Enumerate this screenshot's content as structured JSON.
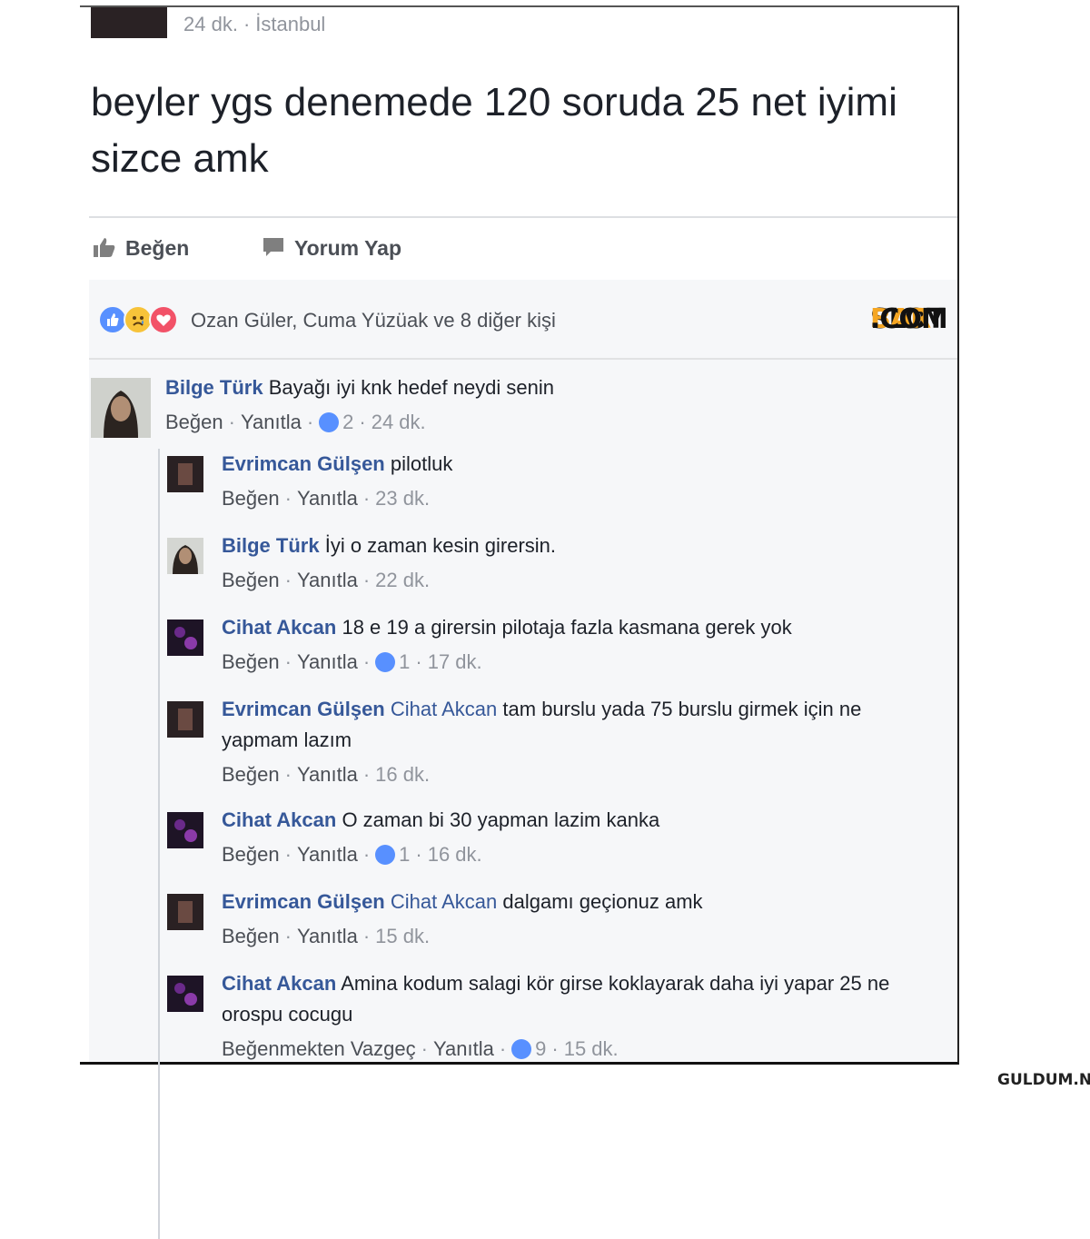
{
  "post": {
    "time": "24 dk.",
    "location": "İstanbul",
    "text": "beyler ygs denemede 120 soruda 25 net iyimi sizce amk"
  },
  "actions": {
    "like": "Beğen",
    "comment": "Yorum Yap"
  },
  "reactions": {
    "text": "Ozan Güler, Cuma Yüzüak ve 8 diğer kişi"
  },
  "comments": [
    {
      "author": "Bilge Türk",
      "text": "Bayağı iyi knk hedef neydi senin",
      "like": "Beğen",
      "reply": "Yanıtla",
      "likes": "2",
      "time": "24 dk."
    },
    {
      "author": "Evrimcan Gülşen",
      "text": "pilotluk",
      "like": "Beğen",
      "reply": "Yanıtla",
      "time": "23 dk."
    },
    {
      "author": "Bilge Türk",
      "text": "İyi o zaman kesin girersin.",
      "like": "Beğen",
      "reply": "Yanıtla",
      "time": "22 dk."
    },
    {
      "author": "Cihat Akcan",
      "text": "18 e 19 a girersin pilotaja fazla kasmana gerek yok",
      "like": "Beğen",
      "reply": "Yanıtla",
      "likes": "1",
      "time": "17 dk."
    },
    {
      "author": "Evrimcan Gülşen",
      "mention": "Cihat Akcan",
      "text": "tam burslu yada 75 burslu girmek için ne yapmam lazım",
      "like": "Beğen",
      "reply": "Yanıtla",
      "time": "16 dk."
    },
    {
      "author": "Cihat Akcan",
      "text": "O zaman bi 30 yapman lazim kanka",
      "like": "Beğen",
      "reply": "Yanıtla",
      "likes": "1",
      "time": "16 dk."
    },
    {
      "author": "Evrimcan Gülşen",
      "mention": "Cihat Akcan",
      "text": "dalgamı geçionuz amk",
      "like": "Beğen",
      "reply": "Yanıtla",
      "time": "15 dk."
    },
    {
      "author": "Cihat Akcan",
      "text": "Amina kodum salagi kör girse koklayarak daha iyi yapar 25 ne orospu cocugu",
      "like": "Beğenmekten Vazgeç",
      "reply": "Yanıtla",
      "likes": "9",
      "time": "15 dk."
    }
  ],
  "watermarks": {
    "slotbar_a": "SLOT",
    "slotbar_b": "BAR",
    "slotbar_c": ".COM",
    "guldum": "GULDUM.NET"
  },
  "colors": {
    "link": "#365899",
    "meta": "#90949c",
    "like_blue": "#5890ff"
  }
}
